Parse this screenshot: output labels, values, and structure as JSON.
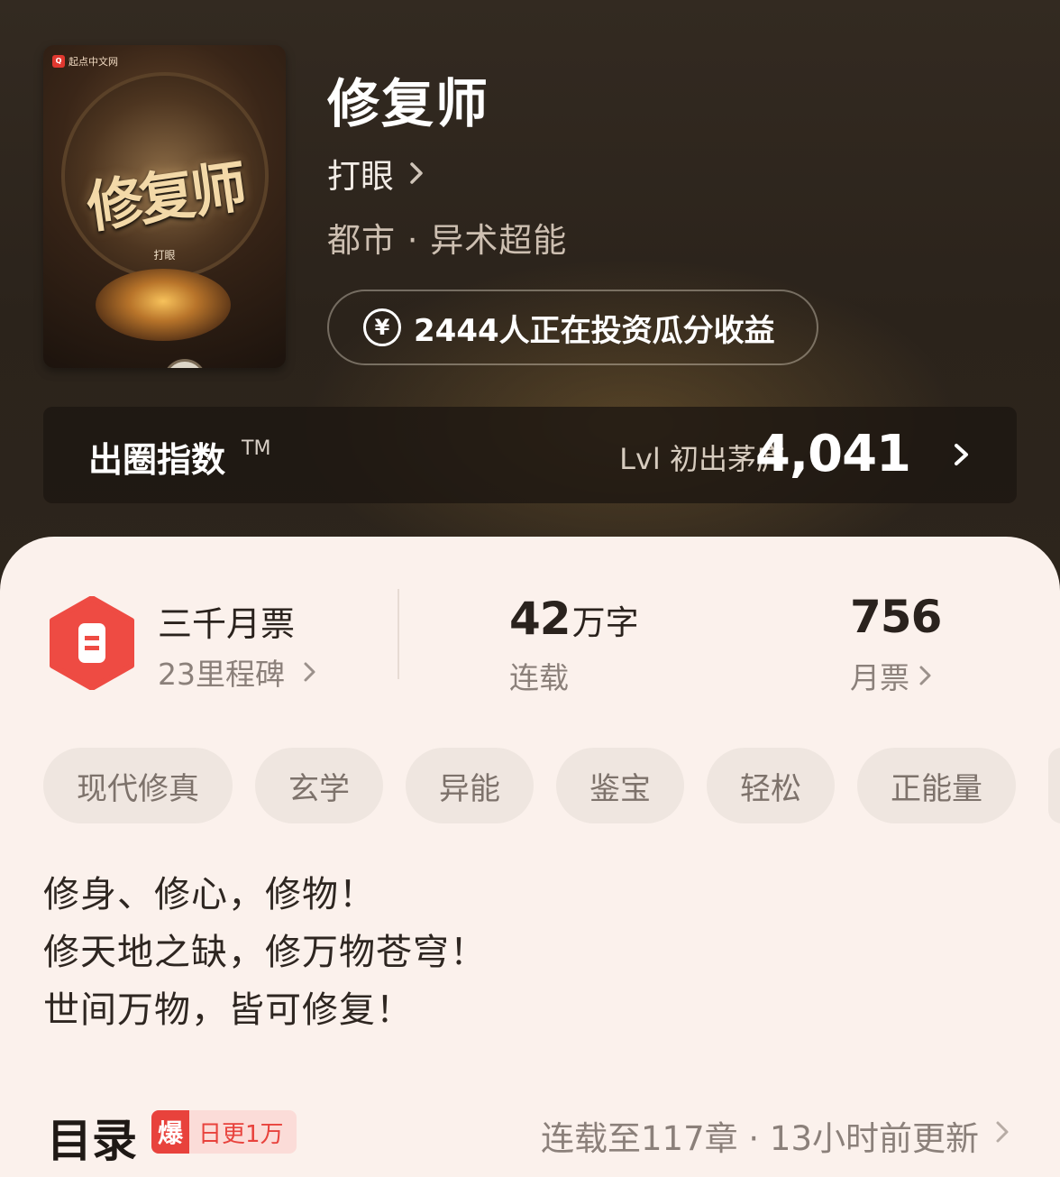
{
  "book": {
    "cover": {
      "publisher": "起点中文网",
      "title": "修复师",
      "author": "打眼"
    },
    "title": "修复师",
    "author": "打眼",
    "category": "都市 · 异术超能",
    "invest_text": "2444人正在投资瓜分收益"
  },
  "index": {
    "label": "出圈指数",
    "tm": "TM",
    "level": "Lvl 初出茅庐",
    "value": "4,041"
  },
  "stats": {
    "milestone_title": "三千月票",
    "milestone_sub": "23里程碑",
    "words_num": "42",
    "words_unit": "万字",
    "words_label": "连载",
    "tickets_value": "756",
    "tickets_label": "月票"
  },
  "tags": [
    "现代修真",
    "玄学",
    "异能",
    "鉴宝",
    "轻松",
    "正能量"
  ],
  "intro": [
    "修身、修心，修物！",
    "修天地之缺，修万物苍穹！",
    "世间万物，皆可修复！"
  ],
  "toc": {
    "title": "目录",
    "badge_icon_text": "爆",
    "badge_text": "日更1万",
    "status": "连载至117章 · 13小时前更新"
  },
  "colors": {
    "accent_red": "#e8423c",
    "content_bg": "#fbf1ec",
    "hero_bg": "#2f261e"
  }
}
